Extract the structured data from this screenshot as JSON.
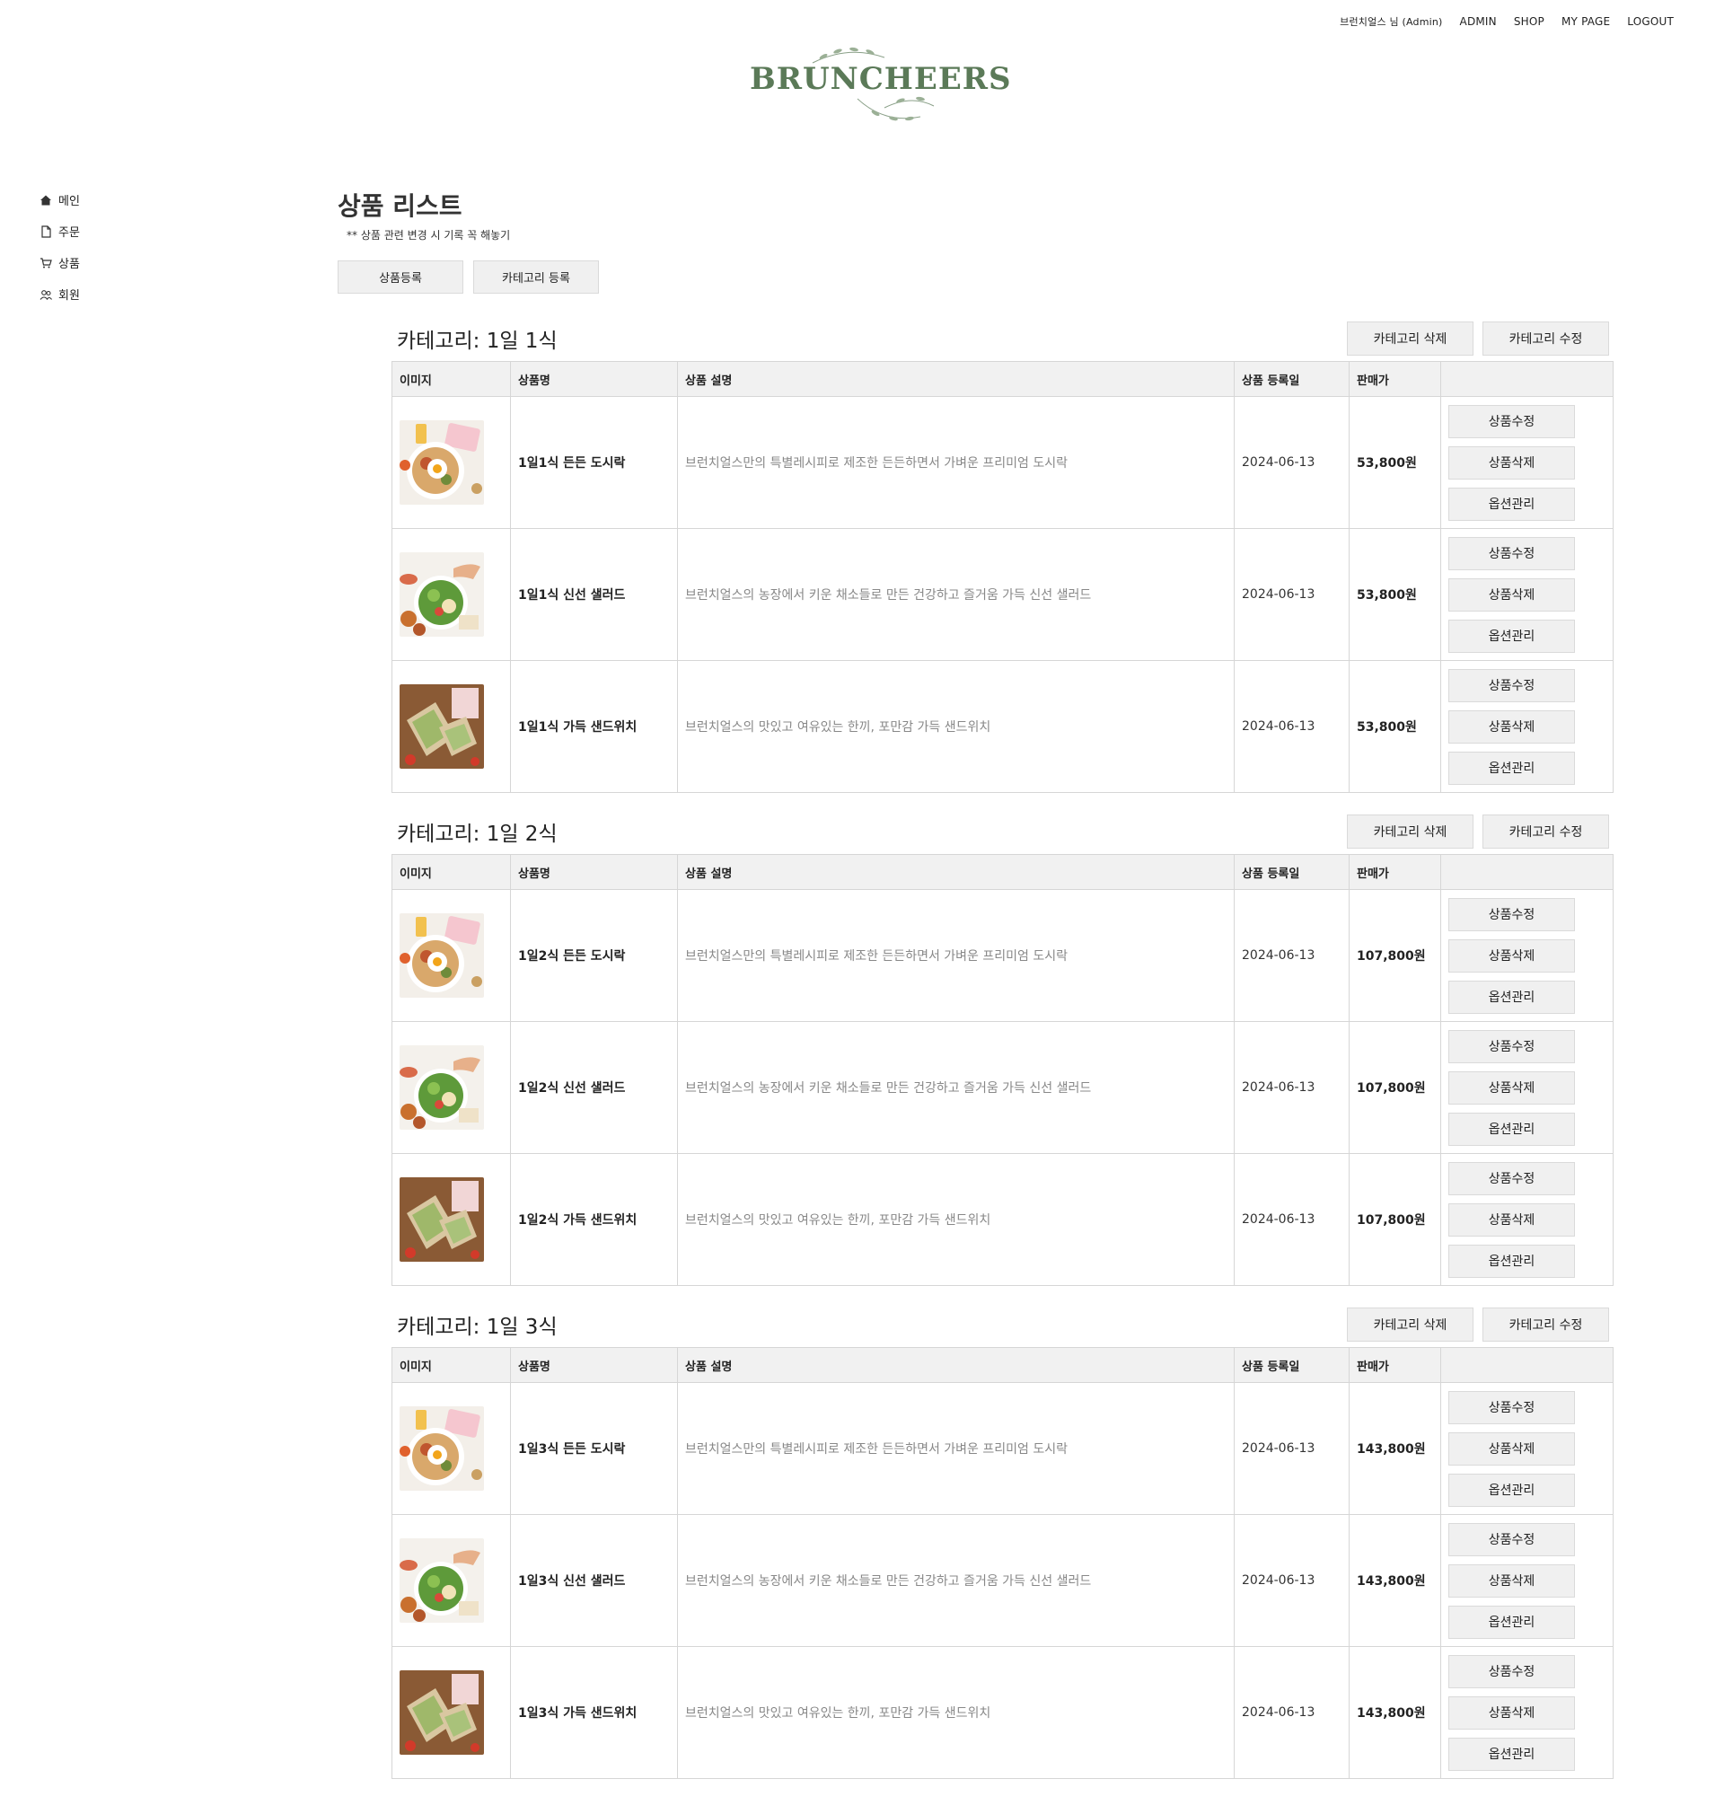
{
  "topnav": {
    "user": "브런치얼스 님 (Admin)",
    "admin": "ADMIN",
    "shop": "SHOP",
    "mypage": "MY PAGE",
    "logout": "LOGOUT"
  },
  "logo": {
    "text": "BRUNCHEERS"
  },
  "sidebar": {
    "items": [
      {
        "label": "메인",
        "icon": "home-icon"
      },
      {
        "label": "주문",
        "icon": "document-icon"
      },
      {
        "label": "상품",
        "icon": "cart-icon"
      },
      {
        "label": "회원",
        "icon": "users-icon"
      }
    ]
  },
  "page": {
    "title": "상품 리스트",
    "note": "** 상품 관련 변경 시 기록 꼭 해놓기",
    "register_product": "상품등록",
    "register_category": "카테고리 등록"
  },
  "table_headers": {
    "image": "이미지",
    "name": "상품명",
    "desc": "상품 설명",
    "date": "상품 등록일",
    "price": "판매가",
    "actions": ""
  },
  "buttons": {
    "cat_delete": "카테고리 삭제",
    "cat_edit": "카테고리 수정",
    "edit": "상품수정",
    "delete": "상품삭제",
    "options": "옵션관리"
  },
  "colors": {
    "brand_green": "#5b7a58",
    "header_bg": "#f1f1f1",
    "button_bg": "#f0f0f0"
  },
  "categories": [
    {
      "title": "카테고리: 1일 1식",
      "products": [
        {
          "image": "dosirak",
          "name": "1일1식 든든 도시락",
          "desc": "브런치얼스만의 특별레시피로 제조한 든든하면서 가벼운 프리미엄 도시락",
          "date": "2024-06-13",
          "price": "53,800원"
        },
        {
          "image": "salad",
          "name": "1일1식 신선 샐러드",
          "desc": "브런치얼스의 농장에서 키운 채소들로 만든 건강하고 즐거움 가득 신선 샐러드",
          "date": "2024-06-13",
          "price": "53,800원"
        },
        {
          "image": "sandwich",
          "name": "1일1식 가득 샌드위치",
          "desc": "브런치얼스의 맛있고 여유있는 한끼, 포만감 가득 샌드위치",
          "date": "2024-06-13",
          "price": "53,800원"
        }
      ]
    },
    {
      "title": "카테고리: 1일 2식",
      "products": [
        {
          "image": "dosirak",
          "name": "1일2식 든든 도시락",
          "desc": "브런치얼스만의 특별레시피로 제조한 든든하면서 가벼운 프리미엄 도시락",
          "date": "2024-06-13",
          "price": "107,800원"
        },
        {
          "image": "salad",
          "name": "1일2식 신선 샐러드",
          "desc": "브런치얼스의 농장에서 키운 채소들로 만든 건강하고 즐거움 가득 신선 샐러드",
          "date": "2024-06-13",
          "price": "107,800원"
        },
        {
          "image": "sandwich",
          "name": "1일2식 가득 샌드위치",
          "desc": "브런치얼스의 맛있고 여유있는 한끼, 포만감 가득 샌드위치",
          "date": "2024-06-13",
          "price": "107,800원"
        }
      ]
    },
    {
      "title": "카테고리: 1일 3식",
      "products": [
        {
          "image": "dosirak",
          "name": "1일3식 든든 도시락",
          "desc": "브런치얼스만의 특별레시피로 제조한 든든하면서 가벼운 프리미엄 도시락",
          "date": "2024-06-13",
          "price": "143,800원"
        },
        {
          "image": "salad",
          "name": "1일3식 신선 샐러드",
          "desc": "브런치얼스의 농장에서 키운 채소들로 만든 건강하고 즐거움 가득 신선 샐러드",
          "date": "2024-06-13",
          "price": "143,800원"
        },
        {
          "image": "sandwich",
          "name": "1일3식 가득 샌드위치",
          "desc": "브런치얼스의 맛있고 여유있는 한끼, 포만감 가득 샌드위치",
          "date": "2024-06-13",
          "price": "143,800원"
        }
      ]
    }
  ]
}
